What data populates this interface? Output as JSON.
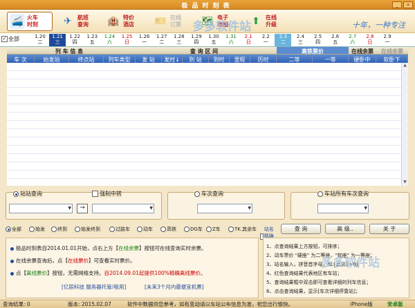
{
  "window": {
    "title": "极品时刻表",
    "min": "_",
    "close": "×"
  },
  "toolbar": {
    "items": [
      {
        "line1": "火车",
        "line2": "时刻"
      },
      {
        "line1": "航班",
        "line2": "查询"
      },
      {
        "line1": "特价",
        "line2": "酒店"
      },
      {
        "line1": "在线",
        "line2": "订票"
      },
      {
        "line1": "电子",
        "line2": "地图"
      },
      {
        "line1": "在线",
        "line2": "升级"
      }
    ],
    "signature": "十年，一种专注",
    "watermark": "多多软件站"
  },
  "dates": {
    "all_label": "全部",
    "days": [
      {
        "date": "1.20",
        "wd": "二"
      },
      {
        "date": "1.21",
        "wd": "三"
      },
      {
        "date": "1.22",
        "wd": "四"
      },
      {
        "date": "1.23",
        "wd": "五"
      },
      {
        "date": "1.24",
        "wd": "六"
      },
      {
        "date": "1.25",
        "wd": "日"
      },
      {
        "date": "1.26",
        "wd": "一"
      },
      {
        "date": "1.27",
        "wd": "二"
      },
      {
        "date": "1.28",
        "wd": "三"
      },
      {
        "date": "1.29",
        "wd": "四"
      },
      {
        "date": "1.30",
        "wd": "五"
      },
      {
        "date": "1.31",
        "wd": "六"
      },
      {
        "date": "2.1",
        "wd": "日"
      },
      {
        "date": "2.2",
        "wd": "一"
      },
      {
        "date": "2.3",
        "wd": "二"
      },
      {
        "date": "2.4",
        "wd": "三"
      },
      {
        "date": "2.5",
        "wd": "四"
      },
      {
        "date": "2.6",
        "wd": "五"
      },
      {
        "date": "2.7",
        "wd": "六"
      },
      {
        "date": "2.8",
        "wd": "日"
      },
      {
        "date": "2.9",
        "wd": "一"
      }
    ]
  },
  "table": {
    "group_headers": [
      "列  车  信  息",
      "查  询  区  间",
      "高铁票价",
      "在线余票",
      "在线余票"
    ],
    "columns": [
      "车  次",
      "始发站",
      "终点站",
      "列车类型",
      "发  站",
      "发时↓",
      "到  站",
      "到时",
      "里程",
      "历时",
      "二等",
      "一等",
      "硬卧中",
      "软卧下"
    ]
  },
  "query": {
    "station_label": "站站查询",
    "transfer_label": "强制中转",
    "train_label": "车次查询",
    "station_all_label": "车站所有车次查询",
    "arrow": "→"
  },
  "filters": [
    "全部",
    "始发",
    "终到",
    "始发终到",
    "过路车",
    "动车",
    "高铁",
    "DG车",
    "Z车",
    "TK.其余车",
    "站名精确匹配"
  ],
  "buttons": {
    "query": "查  询",
    "advanced": "高  级..",
    "about": "关  于"
  },
  "info": {
    "line1a": "极品时刻表自2014.01.01开始，点右上方【",
    "line1b": "在线余票",
    "line1c": "】按钮可在线查询实时余票。",
    "line2a": "在线余票查询后，点【",
    "line2b": "在线票价",
    "line2c": "】可查看实时票价。",
    "line3a": "点【",
    "line3b": "离线票价",
    "line3c": "】按钮，无需网络支持。",
    "line3d": "自2014.09.01起提供100%精确离线票价。",
    "link1": "[亿辰科技 服务器托管/租用]",
    "link2": "[未来3个月内最便宜机票]"
  },
  "tips": [
    "1、点查询结果上方按钮，可排序；",
    "2、动车票价 \"硬座\" 为二等座，\"软座\" 为一等座；",
    "3、站名输入，拼音首字母，如:[北京]->BJ;",
    "4、红色查询结果代表地区有车站；",
    "5、查询结果框中双击即可查看详细的列车信息；",
    "6、点击查询结果，显示[车次详细停靠站]；"
  ],
  "status": {
    "result": "查询结果: 0",
    "version": "版本: 2015.02.07",
    "notice": "软件中数据供您参考，如有变动请以车站公布信息为准，祝您出行愉快。",
    "iphone": "iPhone版",
    "android": "安卓版"
  }
}
